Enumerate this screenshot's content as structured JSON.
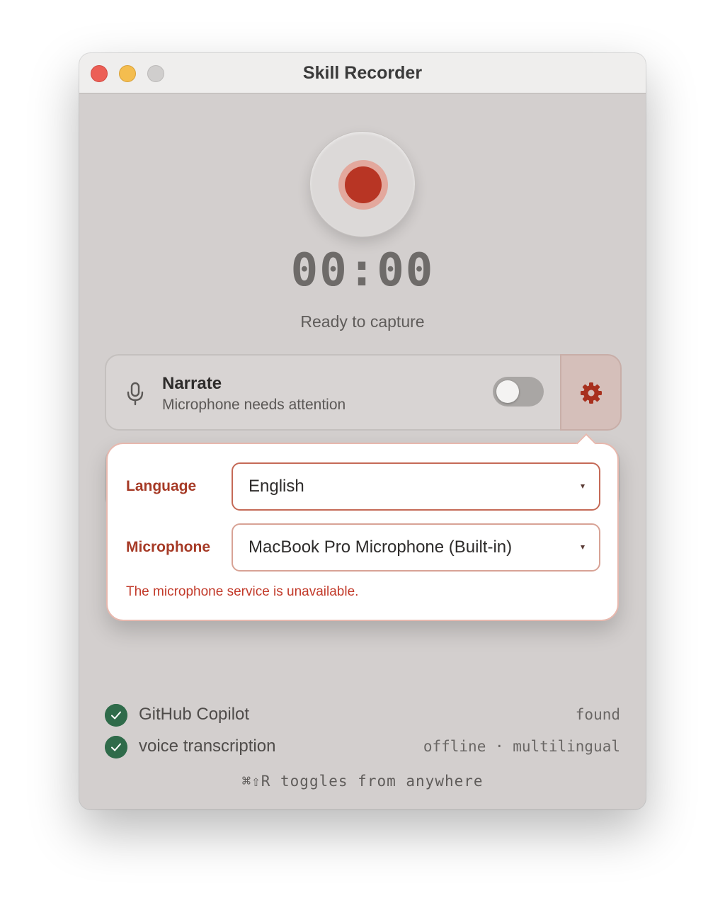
{
  "window": {
    "title": "Skill Recorder"
  },
  "recorder": {
    "timer": "00:00",
    "status": "Ready to capture"
  },
  "narrate": {
    "title": "Narrate",
    "subtitle": "Microphone needs attention",
    "enabled": false
  },
  "settings": {
    "language_label": "Language",
    "language_value": "English",
    "microphone_label": "Microphone",
    "microphone_value": "MacBook Pro Microphone (Built-in)",
    "error": "The microphone service is unavailable."
  },
  "checks": [
    {
      "label": "GitHub Copilot",
      "value": "found",
      "icon": "check-icon"
    },
    {
      "label": "voice transcription",
      "value": "offline · multilingual",
      "icon": "check-icon"
    }
  ],
  "hint": "⌘⇧R toggles from anywhere",
  "colors": {
    "record": "#b83524",
    "accent_label": "#a63a26",
    "error": "#c23a2a",
    "check": "#2f6b4a"
  }
}
